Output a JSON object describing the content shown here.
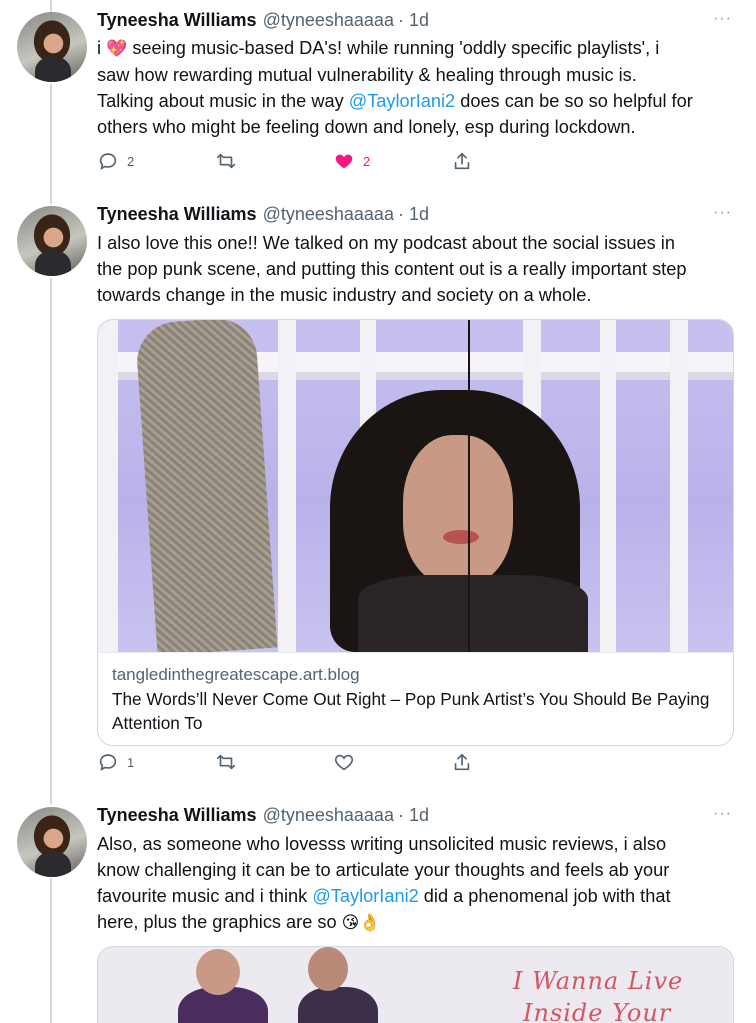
{
  "tweets": [
    {
      "name": "Tyneesha Williams",
      "handle": "@tyneeshaaaaa",
      "time": "· 1d",
      "more": "···",
      "lines": [
        {
          "pre": "i ",
          "emoji": "💖",
          "post": " seeing music-based DA's! while running 'oddly specific playlists', i"
        },
        {
          "text": "saw how rewarding mutual vulnerability & healing through music is."
        },
        {
          "pre": "Talking about music in the way ",
          "mention": "@TaylorIani2",
          "post": " does can be so so helpful for"
        },
        {
          "text": "others who might be feeling down and lonely, esp during lockdown."
        }
      ],
      "actions": {
        "replies": "2",
        "retweets": "",
        "likes": "2",
        "liked": true
      }
    },
    {
      "name": "Tyneesha Williams",
      "handle": "@tyneeshaaaaa",
      "time": "· 1d",
      "more": "···",
      "lines": [
        {
          "text": "I also love this one!! We talked on my podcast about the social issues in"
        },
        {
          "text": "the pop punk scene, and putting this content out is a really important step"
        },
        {
          "text": "towards change in the music industry and society on a whole."
        }
      ],
      "card": {
        "domain": "tangledinthegreatescape.art.blog",
        "title": "The Words’ll Never Come Out Right – Pop Punk Artist’s You Should Be Paying Attention To"
      },
      "actions": {
        "replies": "1",
        "retweets": "",
        "likes": "",
        "liked": false
      }
    },
    {
      "name": "Tyneesha Williams",
      "handle": "@tyneeshaaaaa",
      "time": "· 1d",
      "more": "···",
      "lines": [
        {
          "text": "Also, as someone who lovesss writing unsolicited music reviews, i also"
        },
        {
          "text": "know challenging it can be to articulate your thoughts and feels ab your"
        },
        {
          "pre": "favourite music and i think ",
          "mention": "@TaylorIani2",
          "post": " did a phenomenal job with that"
        },
        {
          "pre": "here, plus the graphics are so ",
          "emoji": "😘👌",
          "post": ""
        }
      ],
      "card": {
        "art_text_1": "I Wanna Live",
        "art_text_2": "Inside Your"
      }
    }
  ],
  "colors": {
    "accent": "#1d9bf0",
    "like": "#f91880",
    "muted": "#536471",
    "border": "#cfd9de"
  },
  "icons": [
    "reply-icon",
    "retweet-icon",
    "like-icon",
    "share-icon",
    "more-icon"
  ]
}
